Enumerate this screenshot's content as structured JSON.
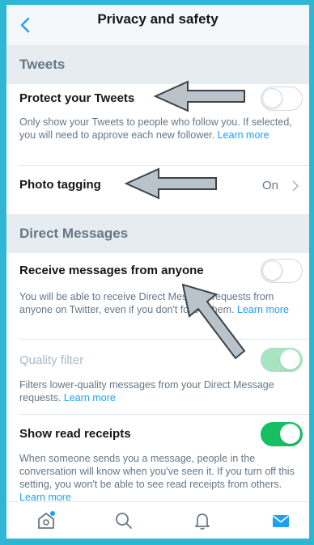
{
  "header": {
    "title": "Privacy and safety",
    "back_icon": "chevron-left-icon"
  },
  "sections": {
    "tweets": {
      "label": "Tweets",
      "protect": {
        "title": "Protect your Tweets",
        "description": "Only show your Tweets to people who follow you. If selected, you will need to approve each new follower.",
        "link": "Learn more",
        "enabled": false
      },
      "photo_tagging": {
        "title": "Photo tagging",
        "value": "On"
      }
    },
    "dm": {
      "label": "Direct Messages",
      "receive_anyone": {
        "title": "Receive messages from anyone",
        "description": "You will be able to receive Direct Message requests from anyone on Twitter, even if you don't follow them.",
        "link": "Learn more",
        "enabled": false
      },
      "quality_filter": {
        "title": "Quality filter",
        "description": "Filters lower-quality messages from your Direct Message requests.",
        "link": "Learn more",
        "enabled": true,
        "disabled": true
      },
      "read_receipts": {
        "title": "Show read receipts",
        "description": "When someone sends you a message, people in the conversation will know when you've seen it. If you turn off this setting, you won't be able to see read receipts from others.",
        "link": "Learn more",
        "enabled": true
      }
    }
  },
  "tabbar": {
    "items": [
      {
        "icon": "home-icon",
        "badge": true
      },
      {
        "icon": "search-icon"
      },
      {
        "icon": "bell-icon"
      },
      {
        "icon": "mail-icon",
        "active": true
      }
    ]
  },
  "colors": {
    "accent": "#1da1f2",
    "toggle_on": "#17bf63",
    "toggle_on_disabled": "#a9e4c2",
    "section_bg": "#e6ecf0",
    "annotation_arrow_fill": "#b9c3c9",
    "page_border": "#2fb6d4"
  },
  "annotations": {
    "type": "arrow",
    "count": 3
  }
}
